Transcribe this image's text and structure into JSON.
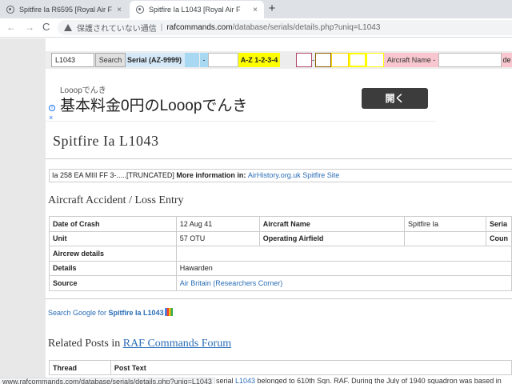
{
  "browser": {
    "tabs": [
      {
        "title": "Spitfire Ia  R6595 [Royal Air F",
        "close": "×",
        "active": false
      },
      {
        "title": "Spitfire Ia  L1043 [Royal Air F",
        "close": "×",
        "active": true
      }
    ],
    "new_tab": "+",
    "nav": {
      "back": "←",
      "forward": "→",
      "reload": "C"
    },
    "security_label": "保護されていない通信",
    "separator": "|",
    "url_host": "rafcommands.com",
    "url_path": "/database/serials/details.php?uniq=L1043"
  },
  "search_bar": {
    "serial_value": "L1043",
    "search_button": "Search",
    "serial_label": "Serial (AZ-9999)",
    "dash": "-",
    "az_label": "A-Z 1-2-3-4",
    "az_dash": "-",
    "aircraft_name_label": "Aircraft Name -",
    "tail_text": "de"
  },
  "ad": {
    "small_text": "Looopでんき",
    "big_text": "基本料金0円のLooopでんき",
    "open_button": "開く",
    "info_icon": "i",
    "close_icon": "×"
  },
  "page_title": "Spitfire Ia  L1043",
  "info_line": {
    "text": "Ia 258 EA MIII FF 3-.....[TRUNCATED] ",
    "more_label": "More information in: ",
    "link": "AirHistory.org.uk Spitfire Site"
  },
  "section_title": "Aircraft Accident / Loss Entry",
  "crash_table": {
    "date_label": "Date of Crash",
    "date_value": "12 Aug 41",
    "aircraft_name_label": "Aircraft Name",
    "aircraft_name_value": "Spitfire Ia",
    "serial_label_cut": "Seria",
    "unit_label": "Unit",
    "unit_value": "57 OTU",
    "airfield_label": "Operating Airfield",
    "airfield_value": "",
    "country_label_cut": "Coun",
    "aircrew_label": "Aircrew details",
    "details_label": "Details",
    "details_value": "Hawarden",
    "source_label": "Source",
    "source_value": "Air Britain (Researchers Corner)"
  },
  "google_search": {
    "prefix": "Search Google for ",
    "term": "Spitfire Ia  L1043"
  },
  "related": {
    "prefix": "Related Posts in ",
    "forum_link": "RAF Commands Forum"
  },
  "posts_table": {
    "thread_header": "Thread",
    "post_header": "Post Text"
  },
  "status_bar": {
    "url": "www.rafcommands.com/database/serials/details.php?uniq=L1043",
    "text_before": "serial ",
    "link": "L1043",
    "text_after": " belonged to 610th Sqn. RAF. During the July of 1940 squadron was based in"
  }
}
